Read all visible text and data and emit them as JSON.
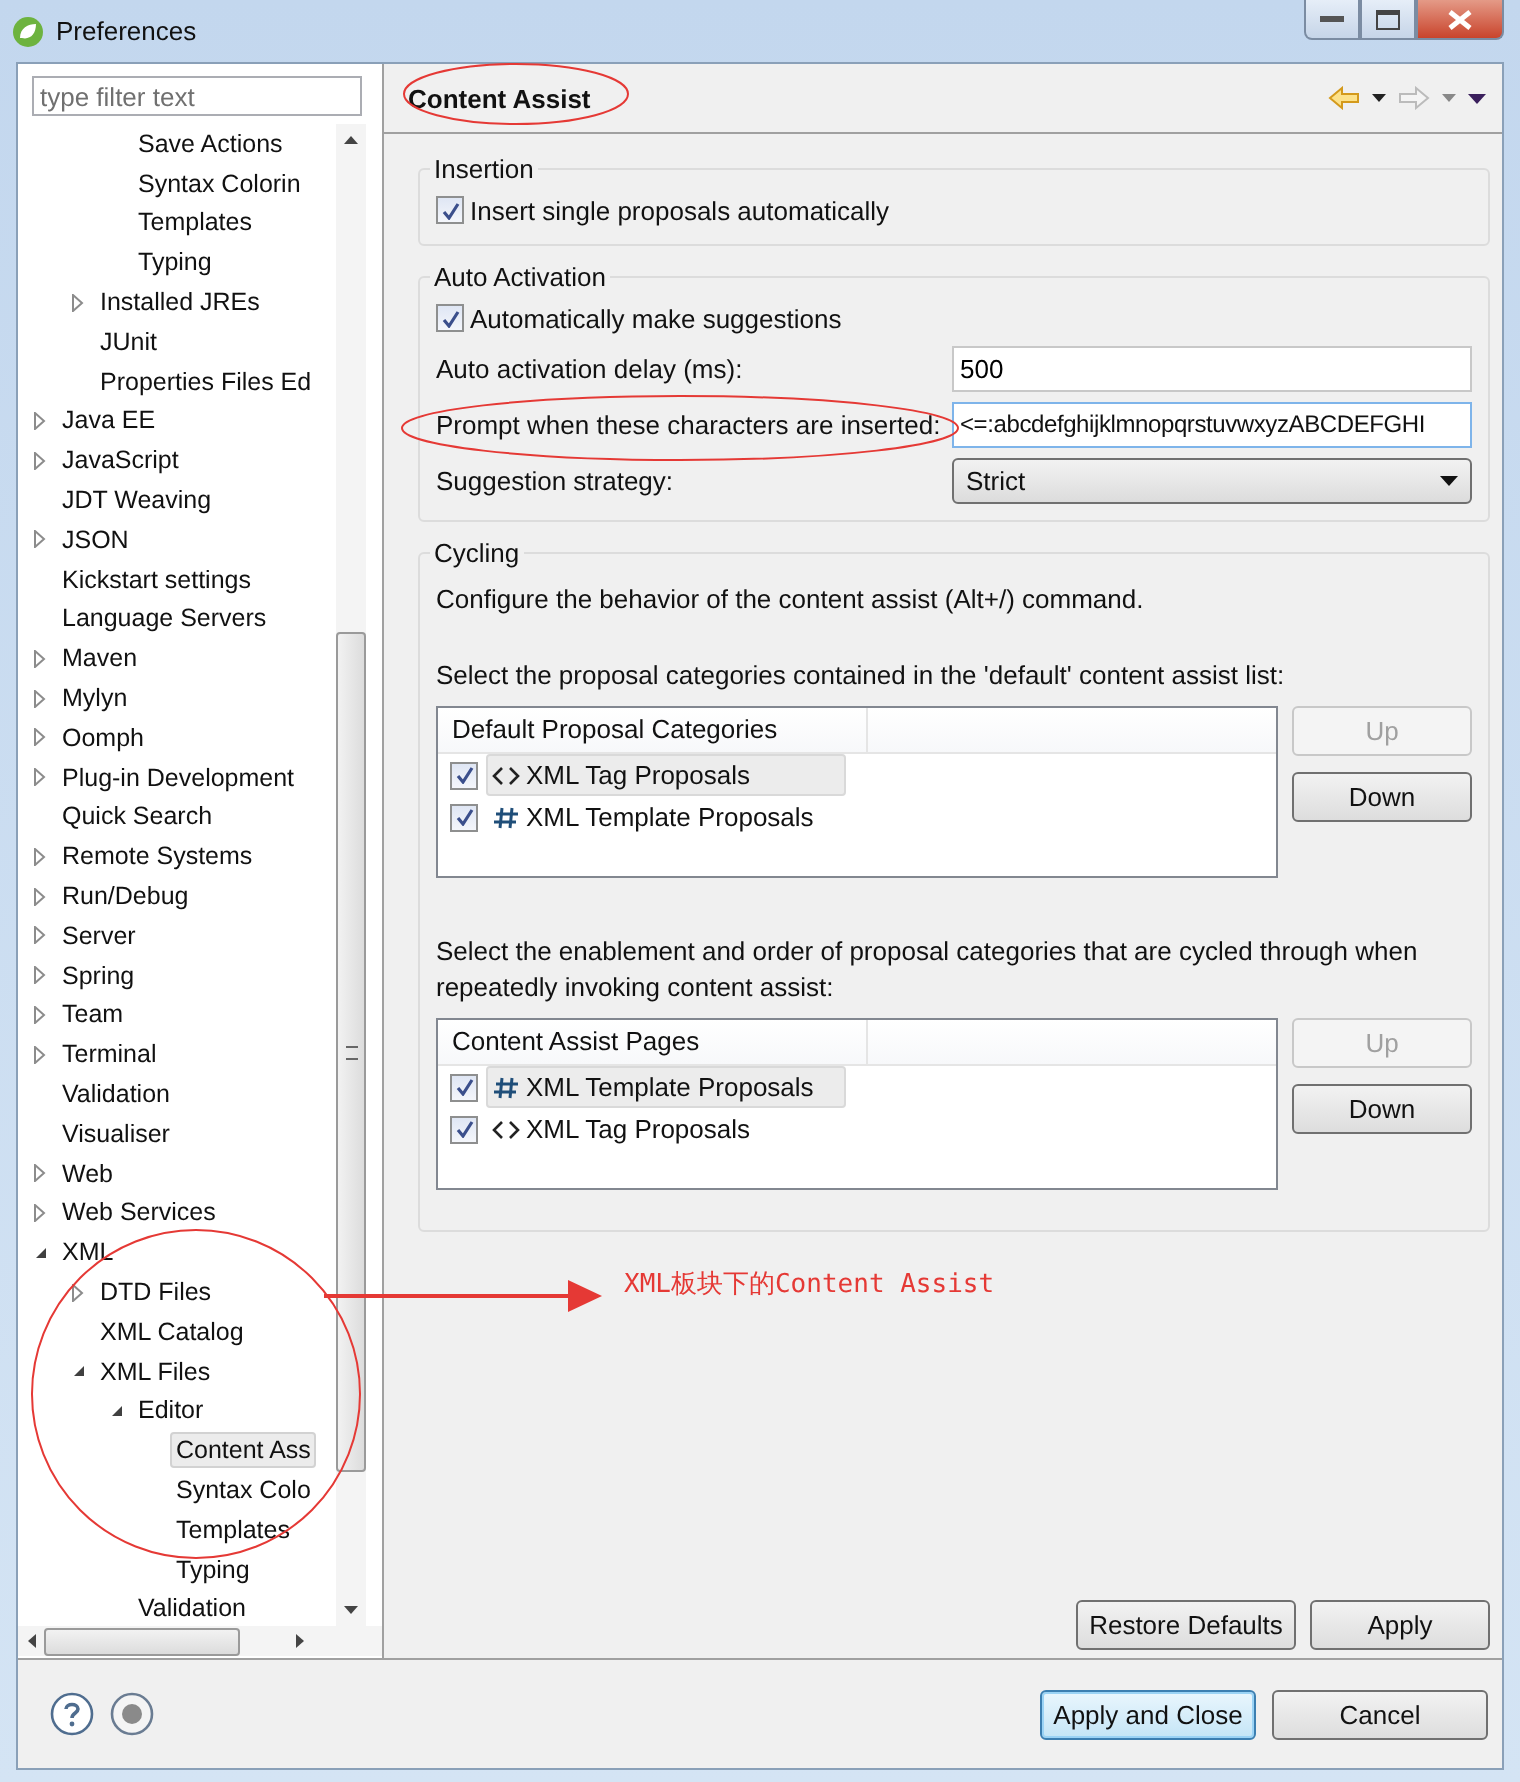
{
  "window": {
    "title": "Preferences"
  },
  "filter": {
    "placeholder": "type filter text"
  },
  "tree": [
    {
      "children": [
        {
          "children": [
            {
              "label": "Save Actions",
              "selected": false
            },
            {
              "label": "Syntax Colorin",
              "selected": false
            },
            {
              "label": "Templates",
              "selected": false
            },
            {
              "label": "Typing",
              "selected": false
            }
          ]
        },
        {
          "label": "Installed JREs",
          "expanded": false,
          "selected": false
        },
        {
          "label": "JUnit",
          "selected": false
        },
        {
          "label": "Properties Files Ed",
          "selected": false
        }
      ]
    },
    {
      "label": "Java EE",
      "expanded": false,
      "selected": false
    },
    {
      "label": "JavaScript",
      "expanded": false,
      "selected": false
    },
    {
      "label": "JDT Weaving",
      "selected": false
    },
    {
      "label": "JSON",
      "expanded": false,
      "selected": false
    },
    {
      "label": "Kickstart settings",
      "selected": false
    },
    {
      "label": "Language Servers",
      "selected": false
    },
    {
      "label": "Maven",
      "expanded": false,
      "selected": false
    },
    {
      "label": "Mylyn",
      "expanded": false,
      "selected": false
    },
    {
      "label": "Oomph",
      "expanded": false,
      "selected": false
    },
    {
      "label": "Plug-in Development",
      "expanded": false,
      "selected": false
    },
    {
      "label": "Quick Search",
      "selected": false
    },
    {
      "label": "Remote Systems",
      "expanded": false,
      "selected": false
    },
    {
      "label": "Run/Debug",
      "expanded": false,
      "selected": false
    },
    {
      "label": "Server",
      "expanded": false,
      "selected": false
    },
    {
      "label": "Spring",
      "expanded": false,
      "selected": false
    },
    {
      "label": "Team",
      "expanded": false,
      "selected": false
    },
    {
      "label": "Terminal",
      "expanded": false,
      "selected": false
    },
    {
      "label": "Validation",
      "selected": false
    },
    {
      "label": "Visualiser",
      "selected": false
    },
    {
      "label": "Web",
      "expanded": false,
      "selected": false
    },
    {
      "label": "Web Services",
      "expanded": false,
      "selected": false
    },
    {
      "label": "XML",
      "expanded": true,
      "selected": false,
      "children": [
        {
          "label": "DTD Files",
          "expanded": false,
          "selected": false
        },
        {
          "label": "XML Catalog",
          "selected": false
        },
        {
          "label": "XML Files",
          "expanded": true,
          "selected": false,
          "children": [
            {
              "label": "Editor",
              "expanded": true,
              "selected": false,
              "children": [
                {
                  "label": "Content Ass",
                  "selected": true
                },
                {
                  "label": "Syntax Colo",
                  "selected": false
                },
                {
                  "label": "Templates",
                  "selected": false
                },
                {
                  "label": "Typing",
                  "selected": false
                }
              ]
            },
            {
              "label": "Validation",
              "selected": false
            }
          ]
        }
      ]
    }
  ],
  "page": {
    "title": "Content Assist",
    "insertion": {
      "title": "Insertion",
      "option": {
        "label": "Insert single proposals automatically",
        "checked": true
      }
    },
    "auto_activation": {
      "title": "Auto Activation",
      "option": {
        "label": "Automatically make suggestions",
        "checked": true
      },
      "delay": {
        "label": "Auto activation delay (ms):",
        "value": "500"
      },
      "prompt": {
        "label": "Prompt when these characters are inserted:",
        "value": "<=:abcdefghijklmnopqrstuvwxyzABCDEFGHI"
      },
      "strategy": {
        "label": "Suggestion strategy:",
        "value": "Strict"
      }
    },
    "cycling": {
      "title": "Cycling",
      "description": "Configure the behavior of the content assist (Alt+/) command.",
      "lists": [
        {
          "intro": "Select the proposal categories contained in the 'default' content assist list:",
          "header": "Default Proposal Categories",
          "rows": [
            {
              "kind": "tag",
              "label": "XML Tag Proposals",
              "checked": true,
              "selected": true
            },
            {
              "kind": "template",
              "label": "XML Template Proposals",
              "checked": true,
              "selected": false
            }
          ],
          "buttons": [
            {
              "label": "Up",
              "disabled": true
            },
            {
              "label": "Down",
              "disabled": false
            }
          ]
        },
        {
          "intro": "Select the enablement and order of proposal categories that are cycled through when repeatedly invoking content assist:",
          "header": "Content Assist Pages",
          "rows": [
            {
              "kind": "template",
              "label": "XML Template Proposals",
              "checked": true,
              "selected": true
            },
            {
              "kind": "tag",
              "label": "XML Tag Proposals",
              "checked": true,
              "selected": false
            }
          ],
          "buttons": [
            {
              "label": "Up",
              "disabled": true
            },
            {
              "label": "Down",
              "disabled": false
            }
          ]
        }
      ]
    },
    "buttons": [
      "Restore Defaults",
      "Apply"
    ]
  },
  "dialog_buttons": [
    {
      "label": "Apply and Close",
      "default": true
    },
    {
      "label": "Cancel",
      "default": false
    }
  ],
  "annotation": {
    "text": "XML板块下的Content Assist"
  }
}
